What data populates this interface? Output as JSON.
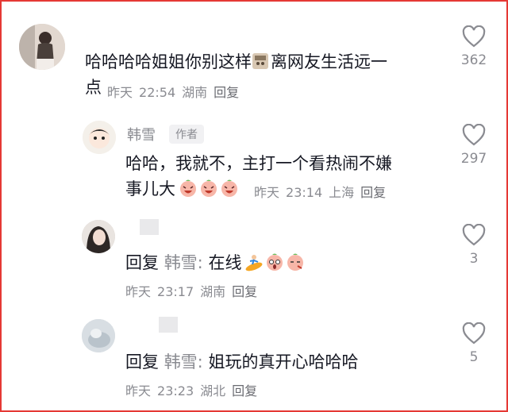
{
  "comments": [
    {
      "text_a": "哈哈哈哈姐姐你别这样",
      "text_b": "离网友生活远一",
      "text_c": "点",
      "date": "昨天",
      "time": "22:54",
      "location": "湖南",
      "reply": "回复",
      "likes": "362"
    },
    {
      "author": "韩雪",
      "author_tag": "作者",
      "text_a": "哈哈，我就不，主打一个看热闹不嫌",
      "text_b": "事儿大",
      "date": "昨天",
      "time": "23:14",
      "location": "上海",
      "reply": "回复",
      "likes": "297"
    },
    {
      "reply_prefix": "回复",
      "reply_to": "韩雪:",
      "text_a": "在线",
      "date": "昨天",
      "time": "23:17",
      "location": "湖南",
      "reply": "回复",
      "likes": "3"
    },
    {
      "reply_prefix": "回复",
      "reply_to": "韩雪:",
      "text_a": "姐玩的真开心哈哈哈",
      "date": "昨天",
      "time": "23:23",
      "location": "湖北",
      "reply": "回复",
      "likes": "5"
    }
  ],
  "icons": {
    "like": "heart-outline-icon",
    "emoji_laugh": "peach-laugh-emoji",
    "emoji_surf": "surfing-emoji",
    "emoji_shock": "peach-shock-emoji",
    "emoji_pout": "peach-pout-emoji",
    "sticker": "sticker-emoji"
  },
  "colors": {
    "frame": "#e53935",
    "text": "#161823",
    "meta": "#8a8b91"
  }
}
